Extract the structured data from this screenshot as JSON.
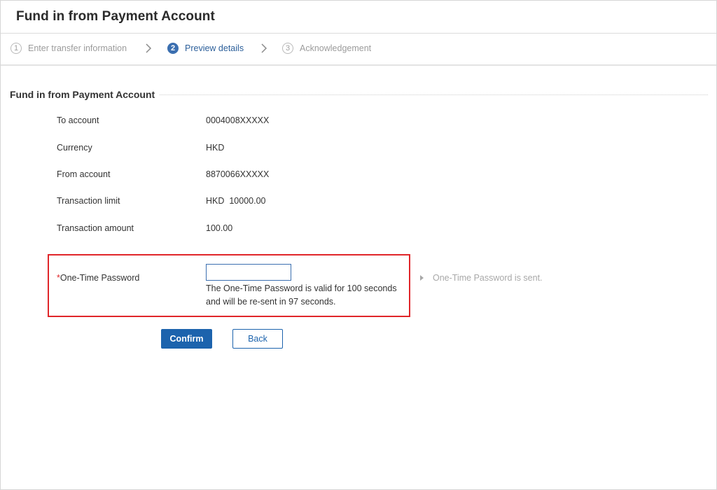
{
  "page": {
    "title": "Fund in from Payment Account"
  },
  "steps": [
    {
      "number": "1",
      "label": "Enter transfer information",
      "state": "inactive"
    },
    {
      "number": "2",
      "label": "Preview details",
      "state": "active"
    },
    {
      "number": "3",
      "label": "Acknowledgement",
      "state": "inactive"
    }
  ],
  "section": {
    "title": "Fund in from Payment Account"
  },
  "details": [
    {
      "label": "To account",
      "value": "0004008XXXXX"
    },
    {
      "label": "Currency",
      "value": "HKD"
    },
    {
      "label": "From account",
      "value": "8870066XXXXX"
    },
    {
      "label": "Transaction limit",
      "value": "HKD  10000.00"
    },
    {
      "label": "Transaction amount",
      "value": "100.00"
    }
  ],
  "otp": {
    "required_mark": "*",
    "label": "One-Time Password",
    "value": "",
    "note_line1": "The One-Time Password is valid for 100 seconds",
    "note_line2": "and will be re-sent in 97 seconds.",
    "status": "One-Time Password is sent."
  },
  "buttons": {
    "confirm": "Confirm",
    "back": "Back"
  },
  "colors": {
    "accent": "#1c63ad",
    "active_step": "#3b6fb0",
    "highlight_border": "#e0262a"
  },
  "icons": {
    "step_separator": "chevron-right-icon",
    "status_bullet": "triangle-right-icon"
  }
}
